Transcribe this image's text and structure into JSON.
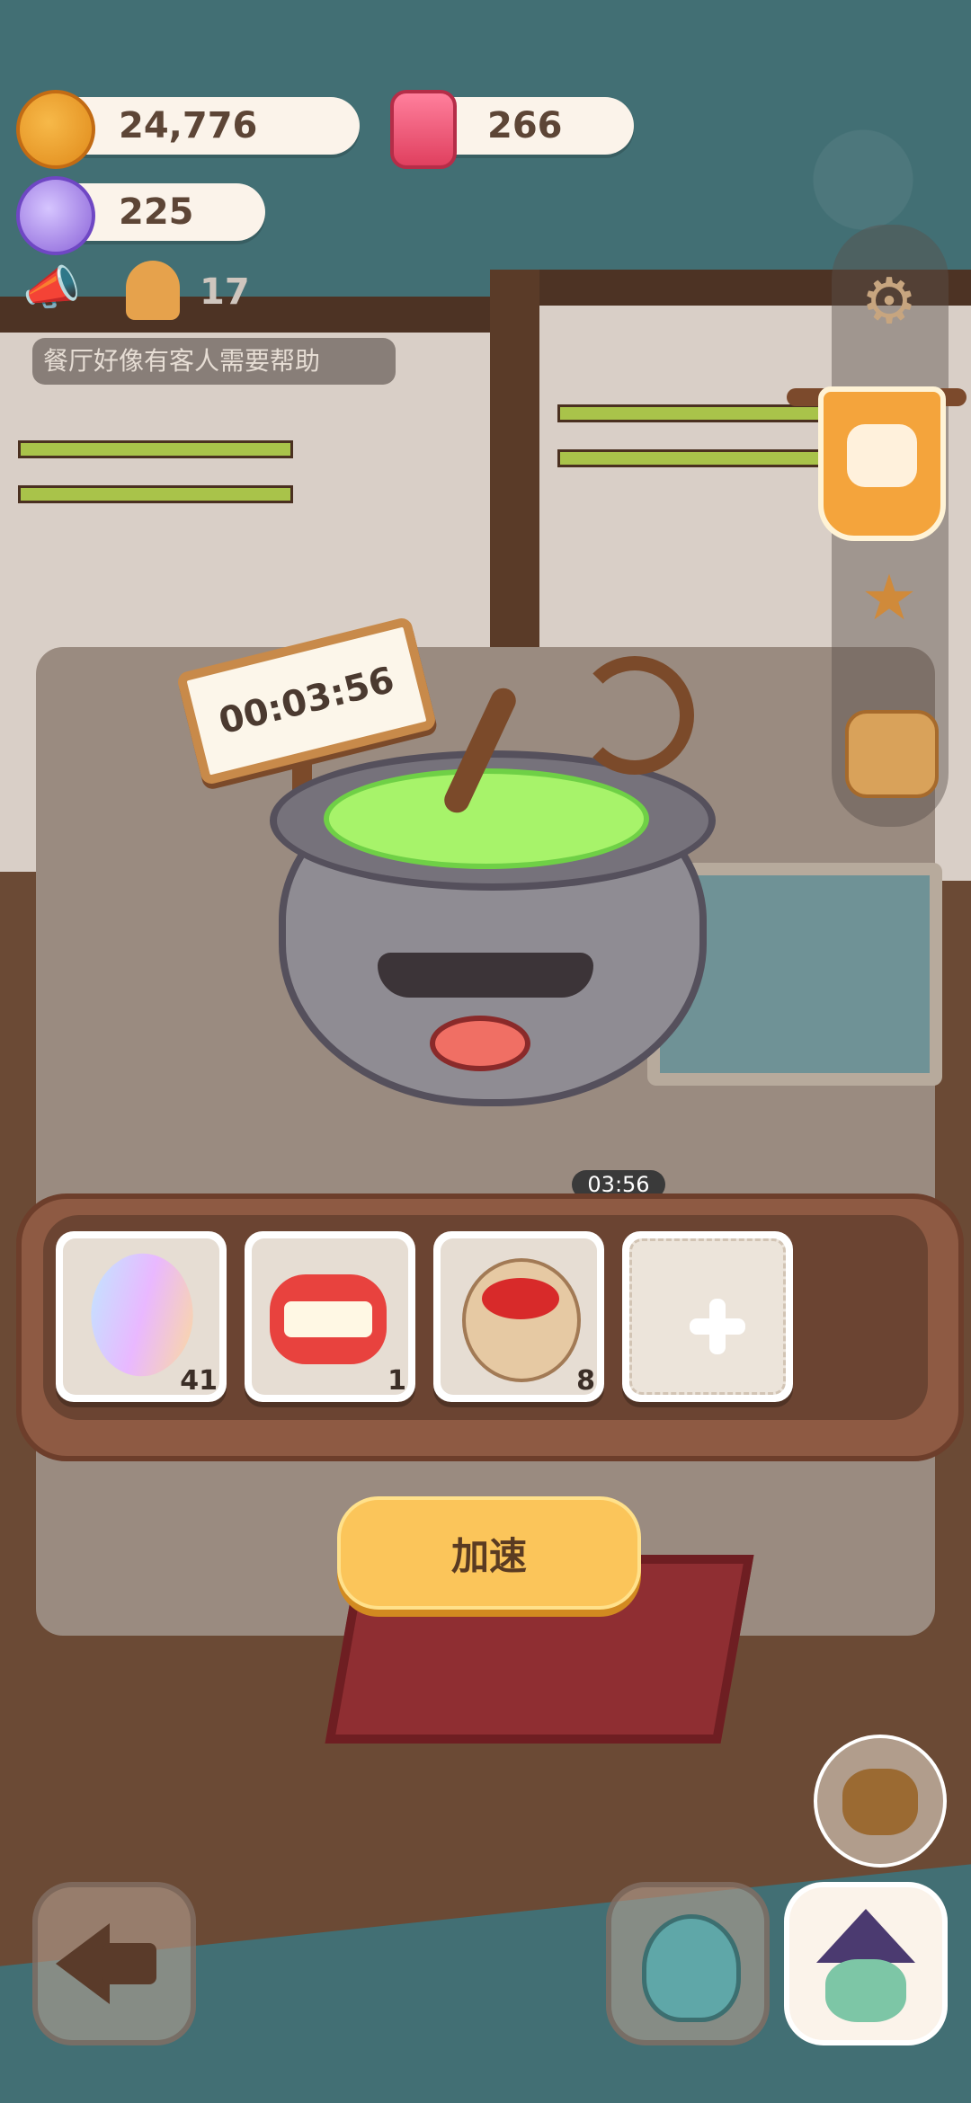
{
  "currency": {
    "cookies": "24,776",
    "candles": "266",
    "gems": "225",
    "gingerbread": "17"
  },
  "notice": "餐厅好像有客人需要帮助",
  "timer": {
    "sign": "00:03:56",
    "mini": "03:56"
  },
  "ingredients": [
    {
      "name": "feather",
      "count": "41"
    },
    {
      "name": "teeth",
      "count": "1"
    },
    {
      "name": "berry-sack",
      "count": "8"
    }
  ],
  "speed_button": "加速",
  "icons": {
    "settings": "gear-icon",
    "camera": "camera-icon",
    "medal": "star-medal-icon",
    "bag": "backpack-icon"
  }
}
